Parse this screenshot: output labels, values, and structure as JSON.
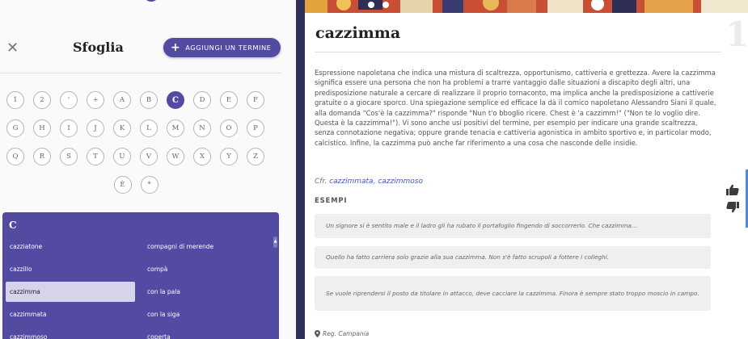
{
  "sidebar": {
    "title": "Sfoglia",
    "add_button_label": "AGGIUNGI UN TERMINE",
    "letter_rows": [
      [
        "1",
        "2",
        "'",
        "+",
        "A",
        "B",
        "C",
        "D",
        "E",
        "F"
      ],
      [
        "G",
        "H",
        "I",
        "J",
        "K",
        "L",
        "M",
        "N",
        "O",
        "P"
      ],
      [
        "Q",
        "R",
        "S",
        "T",
        "U",
        "V",
        "W",
        "X",
        "Y",
        "Z"
      ],
      [
        "È",
        "*"
      ]
    ],
    "active_letter": "C",
    "list_heading": "C",
    "list_col1": [
      "cazziatone",
      "cazzillo",
      "cazzimma",
      "cazzimmata",
      "cazzimmoso"
    ],
    "list_col2": [
      "compagni di merende",
      "compà",
      "con la pala",
      "con la siga",
      "coperta"
    ],
    "selected_item": "cazzimma"
  },
  "entry": {
    "word": "cazzimma",
    "number": "1",
    "definition": "Espressione napoletana che indica una mistura di scaltrezza, opportunismo, cattiveria e grettezza. Avere la cazzimma significa essere una persona che non ha problemi a trarre vantaggio dalle situazioni a discapito degli altri, una predisposizione naturale a cercare di realizzare il proprio tornaconto, ma implica anche la predisposizione a cattiverie gratuite o a giocare sporco. Una spiegazione semplice ed efficace la dà il comico napoletano Alessandro Siani il quale, alla domanda \"Cos'è la cazzimma?\" risponde \"Nun t'o bboglio ricere. Chest è 'a cazzimm!\" (\"Non te lo voglio dire. Questa è la cazzimma!\"). Vi sono anche usi positivi del termine, per esempio per indicare una grande scaltrezza, senza connotazione negativa; oppure grande tenacia e cattiveria agonistica in ambito sportivo e, in particolar modo, calcistico. Infine, la cazzimma può anche far riferimento a una cosa che nasconde delle insidie.",
    "cfr_prefix": "Cfr.",
    "cfr_link1": "cazzimmata",
    "cfr_sep": ",",
    "cfr_link2": "cazzimmoso",
    "examples_heading": "ESEMPI",
    "examples": [
      "Un signore si è sentito male e il ladro gli ha rubato il portafoglio fingendo di soccorrerlo. Che cazzimma...",
      "Quello ha fatto carriera solo grazie alla sua cazzimma. Non s'è fatto scrupoli a fottere i colleghi.",
      "Se vuole riprendersi il posto da titolare in attacco, deve cacciare la cazzimma. Finora è sempre stato troppo moscio in campo."
    ],
    "region": "Reg. Campania"
  },
  "icons": {
    "close": "close-icon",
    "plus": "plus-icon",
    "thumb_up": "thumb-up-icon",
    "thumb_down": "thumb-down-icon",
    "location": "location-pin-icon"
  },
  "colors": {
    "accent": "#534aa1",
    "separator": "#30305a",
    "link": "#3f55b3"
  }
}
